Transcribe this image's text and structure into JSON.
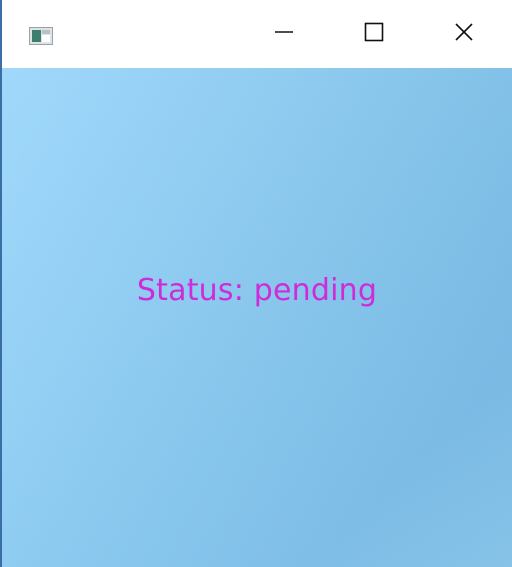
{
  "window": {
    "controls": {
      "minimize_icon": "minimize-icon",
      "maximize_icon": "maximize-icon",
      "close_icon": "close-icon"
    },
    "app_icon": "app-window-icon"
  },
  "content": {
    "status_text": "Status: pending",
    "status_color": "#cf2bd8",
    "background_color": "#8ecdf4"
  }
}
